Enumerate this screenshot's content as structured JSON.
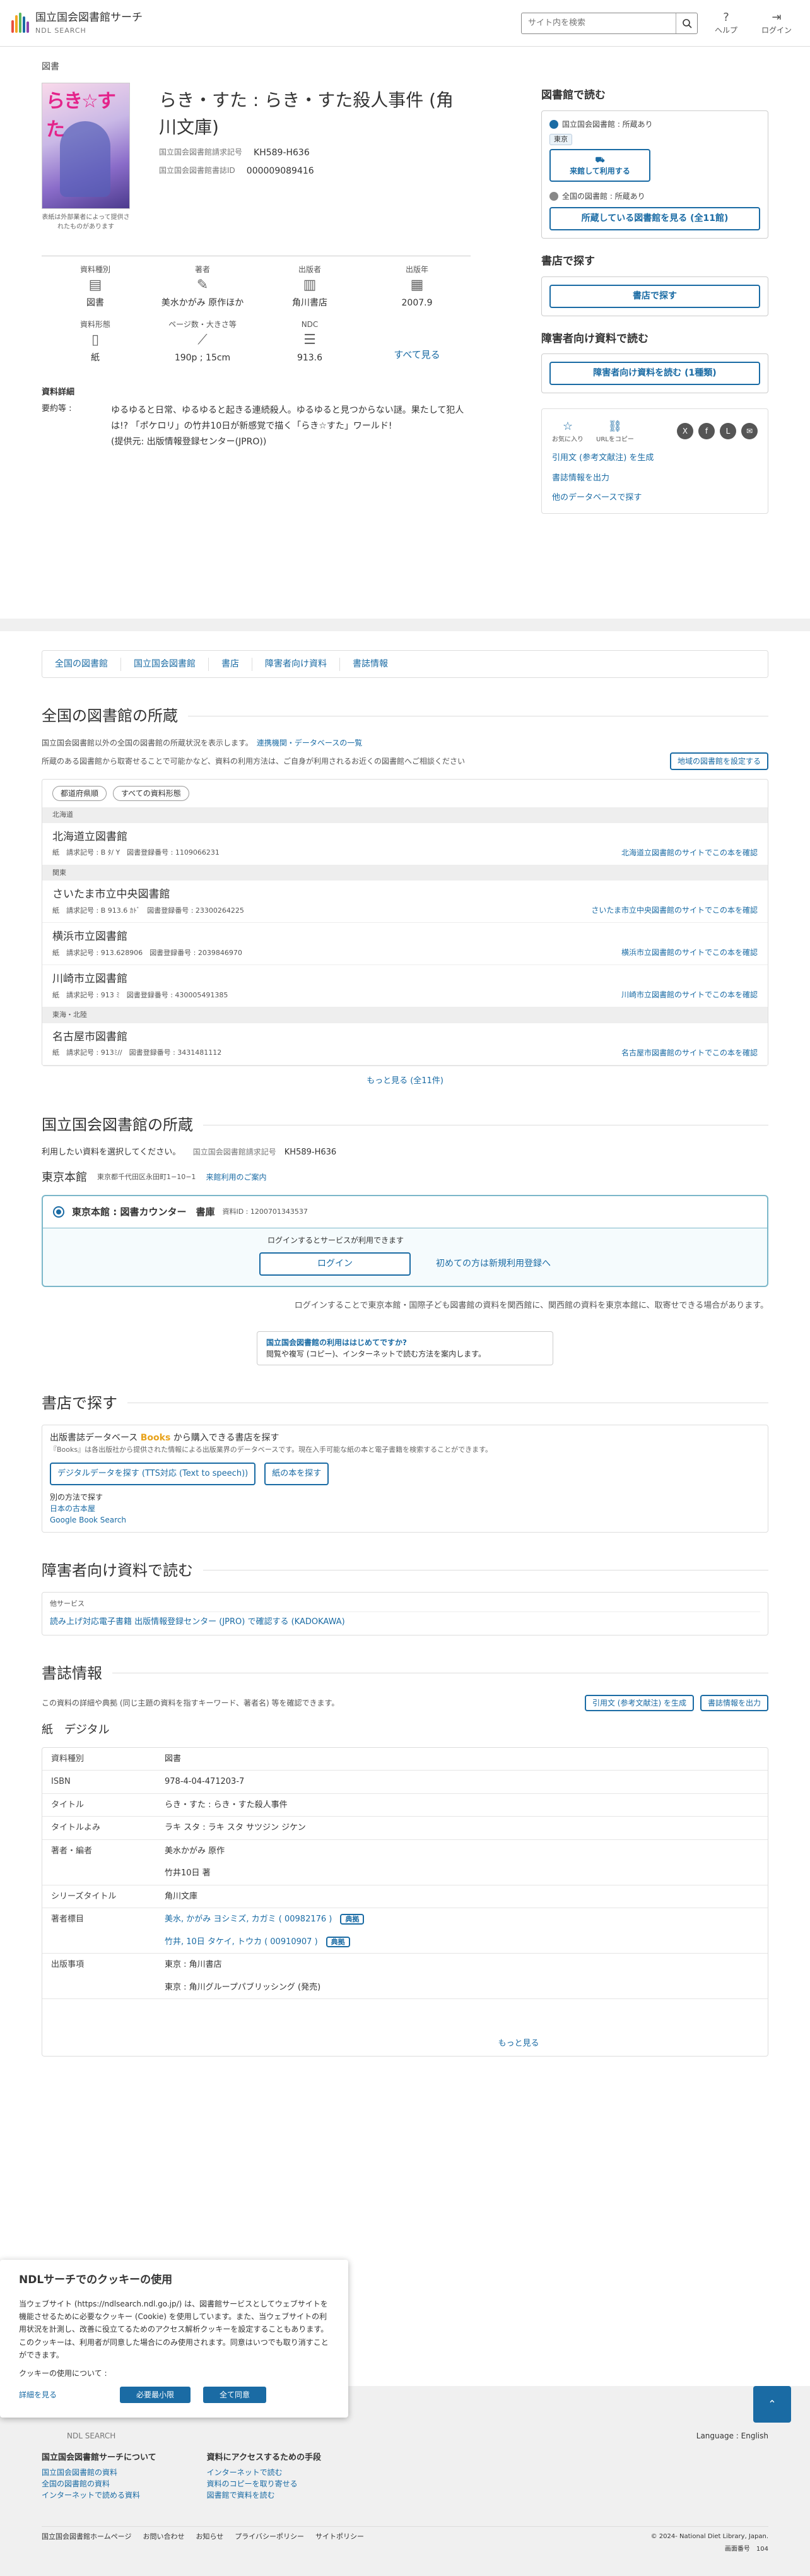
{
  "header": {
    "site_name": "国立国会図書館サーチ",
    "site_sub": "NDL SEARCH",
    "search_placeholder": "サイト内を検索",
    "help": "ヘルプ",
    "login": "ログイン"
  },
  "section_label": "図書",
  "book": {
    "title": "らき・すた : らき・すた殺人事件 (角川文庫)",
    "call_label": "国立国会図書館請求記号",
    "call_no": "KH589-H636",
    "bib_label": "国立国会図書館書誌ID",
    "bib_id": "000009089416",
    "cover_text": "らき☆すた",
    "cover_note": "表紙は外部業者によって提供されたものがあります"
  },
  "facets": [
    {
      "label": "資料種別",
      "value": "図書"
    },
    {
      "label": "著者",
      "value": "美水かがみ 原作ほか"
    },
    {
      "label": "出版者",
      "value": "角川書店"
    },
    {
      "label": "出版年",
      "value": "2007.9"
    },
    {
      "label": "資料形態",
      "value": "紙"
    },
    {
      "label": "ページ数・大きさ等",
      "value": "190p ; 15cm"
    },
    {
      "label": "NDC",
      "value": "913.6"
    }
  ],
  "see_all": "すべて見る",
  "summary": {
    "heading": "資料詳細",
    "key": "要約等 :",
    "text": "ゆるゆると日常、ゆるゆると起きる連続殺人。ゆるゆると見つからない謎。果たして犯人は!? 「ポケロリ」の竹井10日が新感覚で描く「らき☆すた」ワールド!",
    "provider": "(提供元: 出版情報登録センター(JPRO))"
  },
  "side": {
    "h1": "図書館で読む",
    "ndl_line": "国立国会図書館 : 所蔵あり",
    "tokyo": "東京",
    "visit_btn": "来館して利用する",
    "all_line": "全国の図書館 : 所蔵あり",
    "all_btn": "所蔵している図書館を見る (全11館)",
    "h2": "書店で探す",
    "shop_btn": "書店で探す",
    "h3": "障害者向け資料で読む",
    "acc_btn": "障害者向け資料を読む (1種類)",
    "fav": "お気に入り",
    "copy": "URLをコピー",
    "cite": "引用文 (参考文献注) を生成",
    "export": "書誌情報を出力",
    "other": "他のデータベースで探す"
  },
  "tabs": [
    "全国の図書館",
    "国立国会図書館",
    "書店",
    "障害者向け資料",
    "書誌情報"
  ],
  "libs": {
    "h": "全国の図書館の所蔵",
    "p1": "国立国会図書館以外の全国の図書館の所蔵状況を表示します。",
    "p1link": "連携機関・データベースの一覧",
    "p2": "所蔵のある図書館から取寄せることで可能かなど、資料の利用方法は、ご自身が利用されるお近くの図書館へご相談ください",
    "set_btn": "地域の図書館を設定する",
    "filter1": "都道府県順",
    "filter2": "すべての資料形態",
    "rows": [
      {
        "region": "北海道",
        "name": "北海道立図書館",
        "form": "紙",
        "call": "請求記号 : B ﾀ/ Y",
        "reg": "図書登録番号 : 1109066231",
        "link": "北海道立図書館のサイトでこの本を確認"
      },
      {
        "region": "関東",
        "name": "さいたま市立中央図書館",
        "form": "紙",
        "call": "請求記号 : B 913.6 ｶﾄﾞ",
        "reg": "図書登録番号 : 23300264225",
        "link": "さいたま市立中央図書館のサイトでこの本を確認"
      },
      {
        "region": "",
        "name": "横浜市立図書館",
        "form": "紙",
        "call": "請求記号 : 913.628906",
        "reg": "図書登録番号 : 2039846970",
        "link": "横浜市立図書館のサイトでこの本を確認"
      },
      {
        "region": "",
        "name": "川崎市立図書館",
        "form": "紙",
        "call": "請求記号 : 913 ﾐ",
        "reg": "図書登録番号 : 430005491385",
        "link": "川崎市立図書館のサイトでこの本を確認"
      },
      {
        "region": "東海・北陸",
        "name": "名古屋市図書館",
        "form": "紙",
        "call": "請求記号 : 913ﾐ//",
        "reg": "図書登録番号 : 3431481112",
        "link": "名古屋市図書館のサイトでこの本を確認"
      }
    ],
    "more": "もっと見る (全11件)"
  },
  "ndl": {
    "h": "国立国会図書館の所蔵",
    "note": "利用したい資料を選択してください。",
    "call_label": "国立国会図書館請求記号",
    "call_no": "KH589-H636",
    "branch": "東京本館",
    "address": "東京都千代田区永田町1−10−1",
    "guide": "来館利用のご案内",
    "loc": "東京本館 : 図書カウンター　書庫",
    "loc_id": "資料ID : 1200701343537",
    "login_note": "ログインするとサービスが利用できます",
    "login_btn": "ログイン",
    "first": "初めての方は新規利用登録へ",
    "inter": "ログインすることで東京本館・国際子ども図書館の資料を関西館に、関西館の資料を東京本館に、取寄せできる場合があります。",
    "g1": "国立国会図書館の利用ははじめてですか?",
    "g2": "閲覧や複写 (コピー)、インターネットで読む方法を案内します。"
  },
  "shop": {
    "h": "書店で探す",
    "t1": "出版書誌データベース",
    "books": "Books",
    "t2": "から購入できる書店を探す",
    "p": "『Books』は各出版社から提供された情報による出版業界のデータベースです。現在入手可能な紙の本と電子書籍を検索することができます。",
    "b1": "デジタルデータを探す (TTS対応 (Text to speech))",
    "b2": "紙の本を探す",
    "other": "別の方法で探す",
    "l1": "日本の古本屋",
    "l2": "Google Book Search"
  },
  "access": {
    "h": "障害者向け資料で読む",
    "sub": "他サービス",
    "link": "読み上げ対応電子書籍 出版情報登録センター (JPRO) で確認する (KADOKAWA)"
  },
  "biblio": {
    "h": "書誌情報",
    "note": "この資料の詳細や典拠 (同じ主題の資料を指すキーワード、著者名) 等を確認できます。",
    "cite": "引用文 (参考文献注) を生成",
    "export": "書誌情報を出力",
    "paper": "紙",
    "digital": "デジタル",
    "rows": [
      {
        "k": "資料種別",
        "v": "図書"
      },
      {
        "k": "ISBN",
        "v": "978-4-04-471203-7"
      },
      {
        "k": "タイトル",
        "v": "らき・すた : らき・すた殺人事件"
      },
      {
        "k": "タイトルよみ",
        "v": "ラキ スタ : ラキ スタ サツジン ジケン"
      },
      {
        "k": "著者・編者",
        "v": "美水かがみ 原作"
      },
      {
        "k": "",
        "v": "竹井10日 著"
      },
      {
        "k": "シリーズタイトル",
        "v": "角川文庫"
      },
      {
        "k": "著者標目",
        "v": "美水, かがみ ヨシミズ, カガミ ( 00982176 )"
      },
      {
        "k": "",
        "v": "竹井, 10日 タケイ, トウカ ( 00910907 )"
      },
      {
        "k": "出版事項",
        "v": "東京 : 角川書店"
      },
      {
        "k": "",
        "v": "東京 : 角川グループパブリッシング (発売)"
      }
    ],
    "tenkyo": "典拠",
    "more": "もっと見る"
  },
  "cookie": {
    "t": "NDLサーチでのクッキーの使用",
    "p": "当ウェブサイト (https://ndlsearch.ndl.go.jp/) は、図書館サービスとしてウェブサイトを機能させるために必要なクッキー (Cookie) を使用しています。また、当ウェブサイトの利用状況を計測し、改善に役立てるためのアクセス解析クッキーを設定することもあります。このクッキーは、利用者が同意した場合にのみ使用されます。同意はいつでも取り消すことができます。",
    "q": "クッキーの使用について :",
    "detail": "詳細を見る",
    "min": "必要最小限",
    "all": "全て同意"
  },
  "footer": {
    "logo": "NDL SEARCH",
    "lang": "Language : English",
    "c1h": "国立国会図書館サーチについて",
    "c1": [
      "国立国会図書館の資料",
      "全国の図書館の資料",
      "インターネットで読める資料"
    ],
    "c2h": "資料にアクセスするための手段",
    "c2": [
      "インターネットで読む",
      "資料のコピーを取り寄せる",
      "図書館で資料を読む"
    ],
    "bottom": [
      "国立国会図書館ホームページ",
      "お問い合わせ",
      "お知らせ",
      "プライバシーポリシー",
      "サイトポリシー"
    ],
    "copy": "© 2024- National Diet Library, Japan.",
    "ver_label": "画面番号",
    "ver": "104"
  }
}
